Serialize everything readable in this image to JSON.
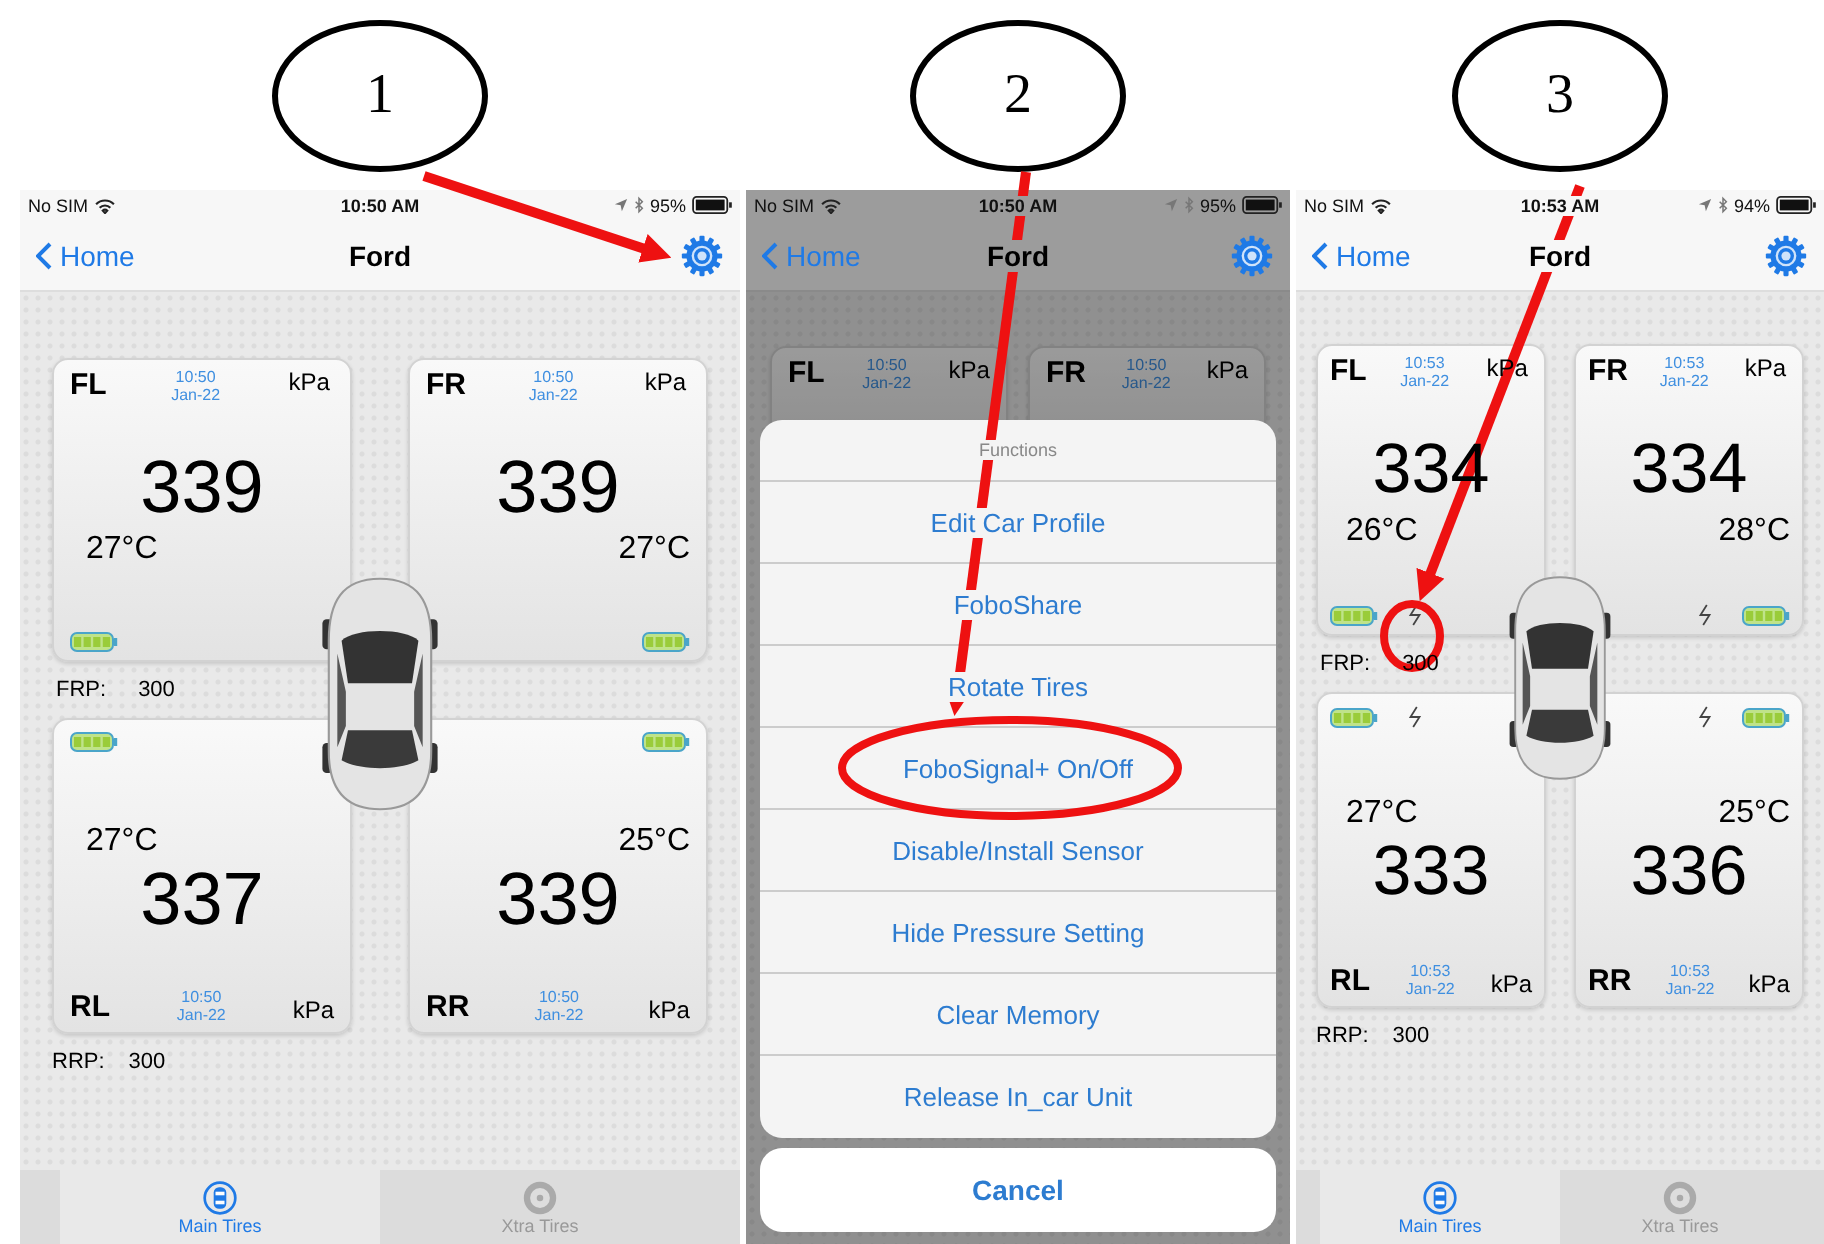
{
  "callouts": [
    {
      "label": "1"
    },
    {
      "label": "2"
    },
    {
      "label": "3"
    }
  ],
  "screens": [
    {
      "kind": "tires",
      "status": {
        "carrier": "No SIM",
        "time": "10:50 AM",
        "battery": "95%"
      },
      "nav": {
        "back": "Home",
        "title": "Ford"
      },
      "tires": [
        {
          "position": "FL",
          "time": "10:50",
          "date": "Jan-22",
          "unit": "kPa",
          "pressure": "339",
          "temperature": "27°C",
          "signal": false
        },
        {
          "position": "FR",
          "time": "10:50",
          "date": "Jan-22",
          "unit": "kPa",
          "pressure": "339",
          "temperature": "27°C",
          "signal": false
        },
        {
          "position": "RL",
          "time": "10:50",
          "date": "Jan-22",
          "unit": "kPa",
          "pressure": "337",
          "temperature": "27°C",
          "signal": false
        },
        {
          "position": "RR",
          "time": "10:50",
          "date": "Jan-22",
          "unit": "kPa",
          "pressure": "339",
          "temperature": "25°C",
          "signal": false
        }
      ],
      "front_pressure": {
        "label": "FRP:",
        "value": "300"
      },
      "rear_pressure": {
        "label": "RRP:",
        "value": "300"
      },
      "tabs": [
        {
          "label": "Main Tires",
          "selected": true
        },
        {
          "label": "Xtra Tires",
          "selected": false
        }
      ]
    },
    {
      "kind": "menu",
      "status": {
        "carrier": "No SIM",
        "time": "10:50 AM",
        "battery": "95%"
      },
      "nav": {
        "back": "Home",
        "title": "Ford"
      },
      "tires": [
        {
          "position": "FL",
          "time": "10:50",
          "date": "Jan-22",
          "unit": "kPa"
        },
        {
          "position": "FR",
          "time": "10:50",
          "date": "Jan-22",
          "unit": "kPa"
        }
      ],
      "menu": {
        "title": "Functions",
        "items": [
          "Edit Car Profile",
          "FoboShare",
          "Rotate Tires",
          "FoboSignal+ On/Off",
          "Disable/Install Sensor",
          "Hide Pressure Setting",
          "Clear Memory",
          "Release In_car Unit"
        ],
        "cancel": "Cancel"
      }
    },
    {
      "kind": "tires",
      "status": {
        "carrier": "No SIM",
        "time": "10:53 AM",
        "battery": "94%"
      },
      "nav": {
        "back": "Home",
        "title": "Ford"
      },
      "tires": [
        {
          "position": "FL",
          "time": "10:53",
          "date": "Jan-22",
          "unit": "kPa",
          "pressure": "334",
          "temperature": "26°C",
          "signal": true
        },
        {
          "position": "FR",
          "time": "10:53",
          "date": "Jan-22",
          "unit": "kPa",
          "pressure": "334",
          "temperature": "28°C",
          "signal": true
        },
        {
          "position": "RL",
          "time": "10:53",
          "date": "Jan-22",
          "unit": "kPa",
          "pressure": "333",
          "temperature": "27°C",
          "signal": true
        },
        {
          "position": "RR",
          "time": "10:53",
          "date": "Jan-22",
          "unit": "kPa",
          "pressure": "336",
          "temperature": "25°C",
          "signal": true
        }
      ],
      "front_pressure": {
        "label": "FRP:",
        "value": "300"
      },
      "rear_pressure": {
        "label": "RRP:",
        "value": "300"
      },
      "tabs": [
        {
          "label": "Main Tires",
          "selected": true
        },
        {
          "label": "Xtra Tires",
          "selected": false
        }
      ]
    }
  ]
}
